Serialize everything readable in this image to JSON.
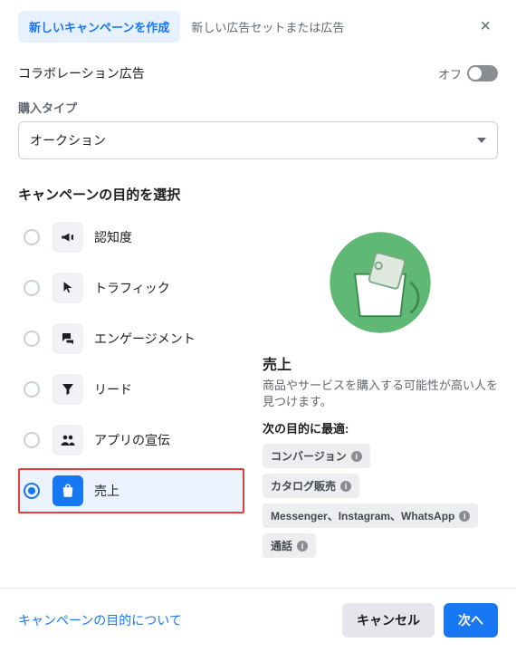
{
  "tabs": {
    "create_campaign": "新しいキャンペーンを作成",
    "new_adset": "新しい広告セットまたは広告"
  },
  "collab": {
    "label": "コラボレーション広告",
    "off_text": "オフ"
  },
  "buying_type": {
    "label": "購入タイプ",
    "value": "オークション"
  },
  "objectives": {
    "title": "キャンペーンの目的を選択",
    "items": [
      {
        "id": "awareness",
        "label": "認知度",
        "icon": "megaphone-icon",
        "selected": false
      },
      {
        "id": "traffic",
        "label": "トラフィック",
        "icon": "cursor-icon",
        "selected": false
      },
      {
        "id": "engagement",
        "label": "エンゲージメント",
        "icon": "chat-icon",
        "selected": false
      },
      {
        "id": "leads",
        "label": "リード",
        "icon": "funnel-icon",
        "selected": false
      },
      {
        "id": "app",
        "label": "アプリの宣伝",
        "icon": "people-icon",
        "selected": false
      },
      {
        "id": "sales",
        "label": "売上",
        "icon": "bag-icon",
        "selected": true
      }
    ]
  },
  "detail": {
    "title": "売上",
    "desc": "商品やサービスを購入する可能性が高い人を見つけます。",
    "best_for_label": "次の目的に最適:",
    "chips": [
      "コンバージョン",
      "カタログ販売",
      "Messenger、Instagram、WhatsApp",
      "通話"
    ]
  },
  "footer": {
    "learn_more": "キャンペーンの目的について",
    "cancel": "キャンセル",
    "next": "次へ"
  }
}
